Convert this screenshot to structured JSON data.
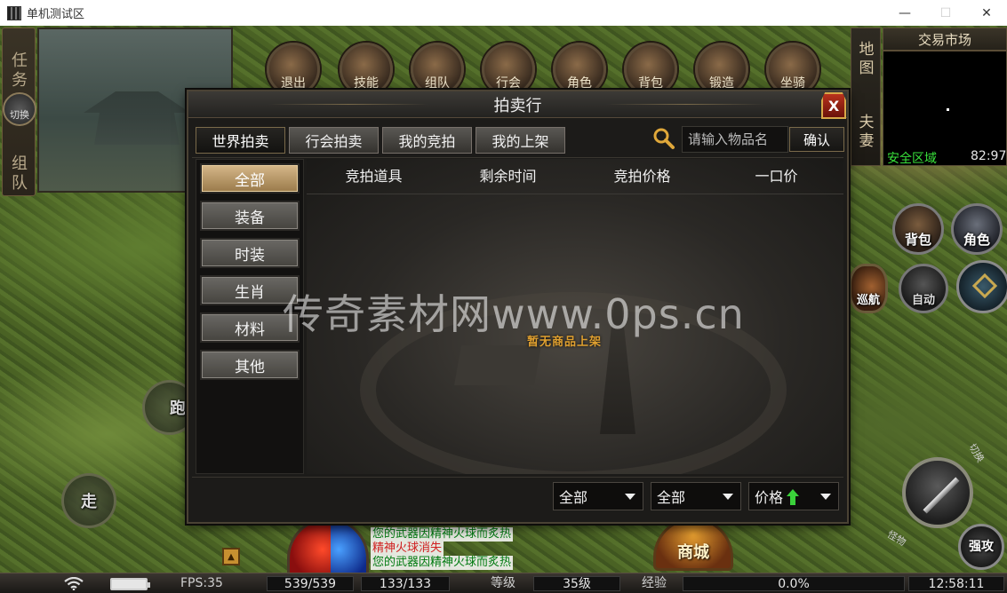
{
  "window": {
    "title": "单机测试区",
    "buttons": {
      "minimize": "—",
      "maximize": "☐",
      "close": "✕"
    }
  },
  "left_panel": {
    "tabs": [
      "任务",
      "组队"
    ],
    "switch_label": "切换"
  },
  "top_menu": [
    {
      "label": "退出",
      "icon": "exit-icon"
    },
    {
      "label": "技能",
      "icon": "skill-book-icon"
    },
    {
      "label": "组队",
      "icon": "team-icon"
    },
    {
      "label": "行会",
      "icon": "guild-icon"
    },
    {
      "label": "角色",
      "icon": "helmet-icon"
    },
    {
      "label": "背包",
      "icon": "bag-icon"
    },
    {
      "label": "锻造",
      "icon": "forge-icon"
    },
    {
      "label": "坐骑",
      "icon": "mount-icon"
    }
  ],
  "right_panel": {
    "map_tabs": [
      "地图",
      "夫妻"
    ],
    "trade_market": "交易市场",
    "safe_zone": "安全区域",
    "coords": "82:97",
    "buttons": {
      "bag": "背包",
      "role": "角色",
      "nav": "巡航",
      "auto": "自动",
      "strong_attack": "强攻",
      "pk_label_1": "切换",
      "pk_label_2": "怪物"
    }
  },
  "movement": {
    "run": "跑",
    "walk": "走"
  },
  "chat": [
    {
      "text": "您的武器因精神火球而炙热",
      "color": "#007a10"
    },
    {
      "text": "精神火球消失",
      "color": "#d02020"
    },
    {
      "text": "您的武器因精神火球而炙热",
      "color": "#007a10"
    }
  ],
  "mall_label": "商城",
  "statusbar": {
    "fps": "FPS:35",
    "hp": "539/539",
    "mp": "133/133",
    "level_label": "等级",
    "level": "35级",
    "exp_label": "经验",
    "exp_percent": "0.0%",
    "exp_value": 0.0,
    "time": "12:58:11"
  },
  "auction": {
    "title": "拍卖行",
    "close": "X",
    "tabs": [
      {
        "label": "世界拍卖",
        "active": true
      },
      {
        "label": "行会拍卖",
        "active": false
      },
      {
        "label": "我的竞拍",
        "active": false
      },
      {
        "label": "我的上架",
        "active": false
      }
    ],
    "search": {
      "placeholder": "请输入物品名",
      "value": ""
    },
    "confirm": "确认",
    "categories": [
      {
        "label": "全部",
        "active": true
      },
      {
        "label": "装备",
        "active": false
      },
      {
        "label": "时装",
        "active": false
      },
      {
        "label": "生肖",
        "active": false
      },
      {
        "label": "材料",
        "active": false
      },
      {
        "label": "其他",
        "active": false
      }
    ],
    "columns": [
      "竞拍道具",
      "剩余时间",
      "竞拍价格",
      "一口价"
    ],
    "rows": [],
    "empty_message": "暂无商品上架",
    "filters": [
      {
        "selected": "全部"
      },
      {
        "selected": "全部"
      },
      {
        "selected": "价格",
        "sort_icon": "arrow-up-icon",
        "sort_color": "#3ad13a"
      }
    ]
  },
  "watermark": "传奇素材网www.0ps.cn"
}
